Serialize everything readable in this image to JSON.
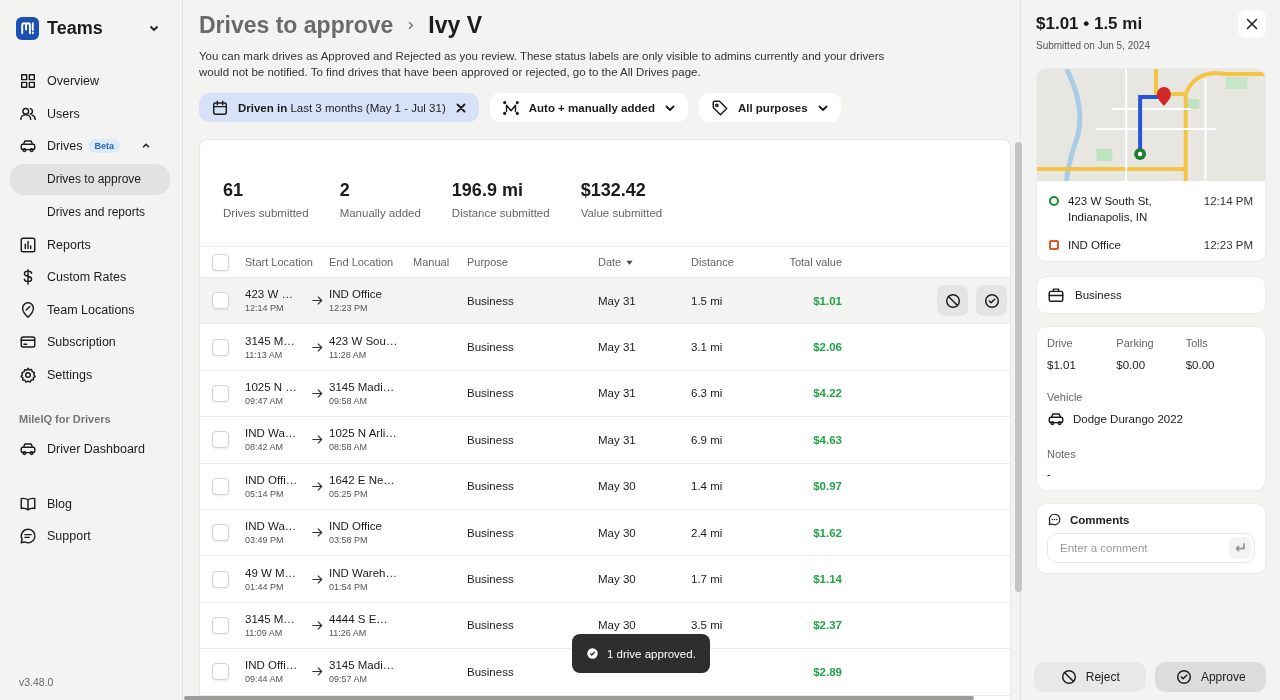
{
  "sidebar": {
    "brand": "Teams",
    "nav": [
      {
        "label": "Overview",
        "selected": false
      },
      {
        "label": "Users",
        "selected": false
      },
      {
        "label": "Drives",
        "badge": "Beta",
        "expanded": true,
        "selected": false,
        "children": [
          {
            "label": "Drives to approve",
            "selected": true
          },
          {
            "label": "Drives and reports",
            "selected": false
          }
        ]
      },
      {
        "label": "Reports",
        "selected": false
      },
      {
        "label": "Custom Rates",
        "selected": false
      },
      {
        "label": "Team Locations",
        "selected": false
      },
      {
        "label": "Subscription",
        "selected": false
      },
      {
        "label": "Settings",
        "selected": false
      }
    ],
    "section_title": "MileIQ for Drivers",
    "driver_nav": [
      {
        "label": "Driver Dashboard",
        "selected": false
      }
    ],
    "footer_nav": [
      {
        "label": "Blog",
        "selected": false
      },
      {
        "label": "Support",
        "selected": false
      }
    ],
    "version": "v3.48.0"
  },
  "page": {
    "breadcrumb": "Drives to approve",
    "title": "Ivy V",
    "description": "You can mark drives as Approved and Rejected as you review. These status labels are only visible to admins currently and your drivers would not be notified. To find drives that have been approved or rejected, go to the All Drives page.",
    "filters": [
      {
        "label": "**Driven in** Last 3 months (May 1 - Jul 31)",
        "active": true
      },
      {
        "label": "Auto + manually added",
        "active": false
      },
      {
        "label": "All purposes",
        "active": false
      }
    ]
  },
  "stats": [
    {
      "value": "61",
      "label": "Drives submitted"
    },
    {
      "value": "2",
      "label": "Manually added"
    },
    {
      "value": "196.9 mi",
      "label": "Distance submitted"
    },
    {
      "value": "$132.42",
      "label": "Value submitted"
    }
  ],
  "table": {
    "all_checked": false,
    "columns": [
      {
        "label": "Start Location",
        "sorted": false
      },
      {
        "label": "End Location",
        "sorted": false
      },
      {
        "label": "Manual",
        "sorted": false
      },
      {
        "label": "Purpose",
        "sorted": false
      },
      {
        "label": "Date",
        "sorted": true
      },
      {
        "label": "Distance",
        "sorted": false
      },
      {
        "label": "Total value",
        "sorted": false
      }
    ],
    "rows": [
      {
        "start": "423 W …",
        "start_time": "12:14 PM",
        "end": "IND Office",
        "end_time": "12:23 PM",
        "purpose": "Business",
        "date": "May 31",
        "distance": "1.5 mi",
        "value": "$1.01",
        "checked": false,
        "selected": true
      },
      {
        "start": "3145 M…",
        "start_time": "11:13 AM",
        "end": "423 W Sou…",
        "end_time": "11:28 AM",
        "purpose": "Business",
        "date": "May 31",
        "distance": "3.1 mi",
        "value": "$2.06",
        "checked": false,
        "selected": false
      },
      {
        "start": "1025 N …",
        "start_time": "09:47 AM",
        "end": "3145 Madi…",
        "end_time": "09:58 AM",
        "purpose": "Business",
        "date": "May 31",
        "distance": "6.3 mi",
        "value": "$4.22",
        "checked": false,
        "selected": false
      },
      {
        "start": "IND Wa…",
        "start_time": "08:42 AM",
        "end": "1025 N Arli…",
        "end_time": "08:58 AM",
        "purpose": "Business",
        "date": "May 31",
        "distance": "6.9 mi",
        "value": "$4.63",
        "checked": false,
        "selected": false
      },
      {
        "start": "IND Offi…",
        "start_time": "05:14 PM",
        "end": "1642 E Ne…",
        "end_time": "05:25 PM",
        "purpose": "Business",
        "date": "May 30",
        "distance": "1.4 mi",
        "value": "$0.97",
        "checked": false,
        "selected": false
      },
      {
        "start": "IND Wa…",
        "start_time": "03:49 PM",
        "end": "IND Office",
        "end_time": "03:58 PM",
        "purpose": "Business",
        "date": "May 30",
        "distance": "2.4 mi",
        "value": "$1.62",
        "checked": false,
        "selected": false
      },
      {
        "start": "49 W M…",
        "start_time": "01:44 PM",
        "end": "IND Wareh…",
        "end_time": "01:54 PM",
        "purpose": "Business",
        "date": "May 30",
        "distance": "1.7 mi",
        "value": "$1.14",
        "checked": false,
        "selected": false
      },
      {
        "start": "3145 M…",
        "start_time": "11:09 AM",
        "end": "4444 S E…",
        "end_time": "11:26 AM",
        "purpose": "Business",
        "date": "May 30",
        "distance": "3.5 mi",
        "value": "$2.37",
        "checked": false,
        "selected": false
      },
      {
        "start": "IND Offi…",
        "start_time": "09:44 AM",
        "end": "3145 Madi…",
        "end_time": "09:57 AM",
        "purpose": "Business",
        "value": "$2.89",
        "checked": false,
        "selected": false
      }
    ]
  },
  "toast": {
    "text": "1 drive approved."
  },
  "detail": {
    "title": "$1.01 • 1.5 mi",
    "submitted": "Submitted on Jun 5, 2024",
    "stops": [
      {
        "kind": "start",
        "address": "423 W South St, Indianapolis, IN",
        "time": "12:14 PM"
      },
      {
        "kind": "end",
        "address": "IND Office",
        "time": "12:23 PM"
      }
    ],
    "purpose": "Business",
    "costs": [
      {
        "label": "Drive",
        "value": "$1.01"
      },
      {
        "label": "Parking",
        "value": "$0.00"
      },
      {
        "label": "Tolls",
        "value": "$0.00"
      }
    ],
    "vehicle_label": "Vehicle",
    "vehicle": "Dodge Durango 2022",
    "notes_label": "Notes",
    "notes": "-",
    "comments_title": "Comments",
    "comment_placeholder": "Enter a comment",
    "buttons": [
      {
        "kind": "reject",
        "label": "Reject"
      },
      {
        "kind": "approve",
        "label": "Approve"
      }
    ]
  }
}
